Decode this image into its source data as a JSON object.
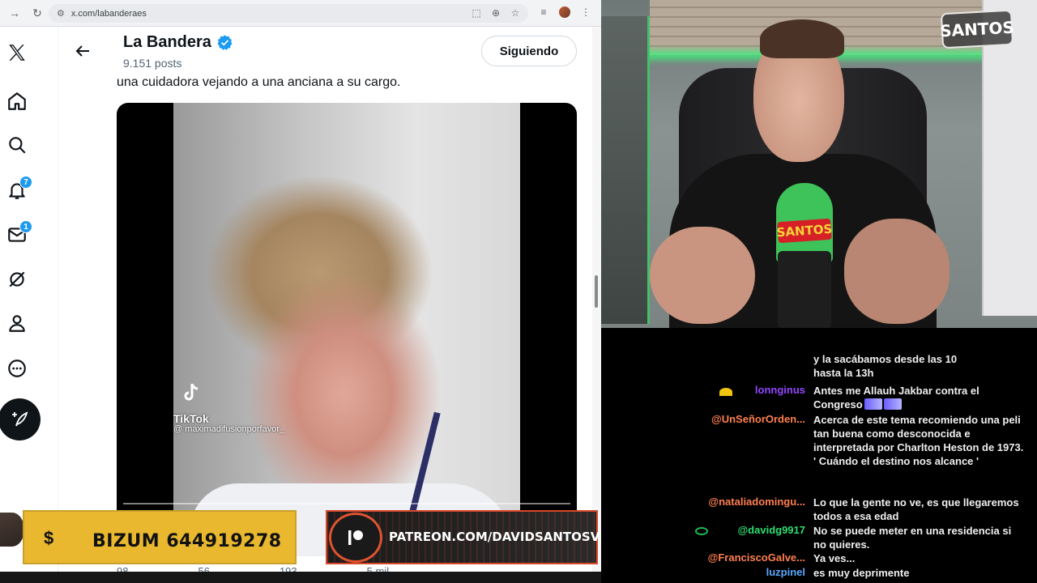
{
  "browser": {
    "url": "x.com/labanderaes"
  },
  "x_sidebar": {
    "notifications_badge": "7",
    "messages_badge": "1"
  },
  "profile_header": {
    "name": "La Bandera",
    "posts": "9.151 posts",
    "follow_label": "Siguiendo"
  },
  "tweet": {
    "text": "una cuidadora vejando a una anciana a su cargo.",
    "video_watermark": "TikTok",
    "video_user": "@ maximadifusionporfavor_",
    "actions": [
      "98",
      "56",
      "193",
      "5 mil"
    ]
  },
  "overlay": {
    "bizum_symbol": "$",
    "bizum_text": "BIZUM 644919278",
    "patreon_text": "PATREON.COM/DAVIDSANTOSVLOG"
  },
  "webcam": {
    "logo_text": "SANTOS",
    "mic_label": "SANTOS"
  },
  "chat": {
    "messages": [
      {
        "user": "",
        "user_color": "#efeff1",
        "text_line1": "y la sacábamos desde las 10",
        "text_line2": "hasta la 13h"
      },
      {
        "user": "lonnginus",
        "user_color": "#9147ff",
        "badge": "gold",
        "text": "Antes me Allauh Jakbar contra el Congreso"
      },
      {
        "user": "@UnSeñorOrden...",
        "user_color": "#ff7f50",
        "text": "Acerca de este tema recomiendo una peli tan buena como desconocida e interpretada por Charlton Heston de 1973. ' Cuándo el destino nos alcance '"
      },
      {
        "user": "@nataliadomingu...",
        "user_color": "#ff7f50",
        "text": "Lo que la gente no ve, es que llegaremos todos a esa edad"
      },
      {
        "user": "@davidg9917",
        "user_color": "#2fdc71",
        "badge": "green",
        "text": "No se puede meter en una residencia si no quieres."
      },
      {
        "user": "@FranciscoGalve...",
        "user_color": "#ff7f50",
        "text": "Ya ves..."
      },
      {
        "user": "luzpinel",
        "user_color": "#5aa9ff",
        "text": "es muy deprimente"
      }
    ]
  }
}
